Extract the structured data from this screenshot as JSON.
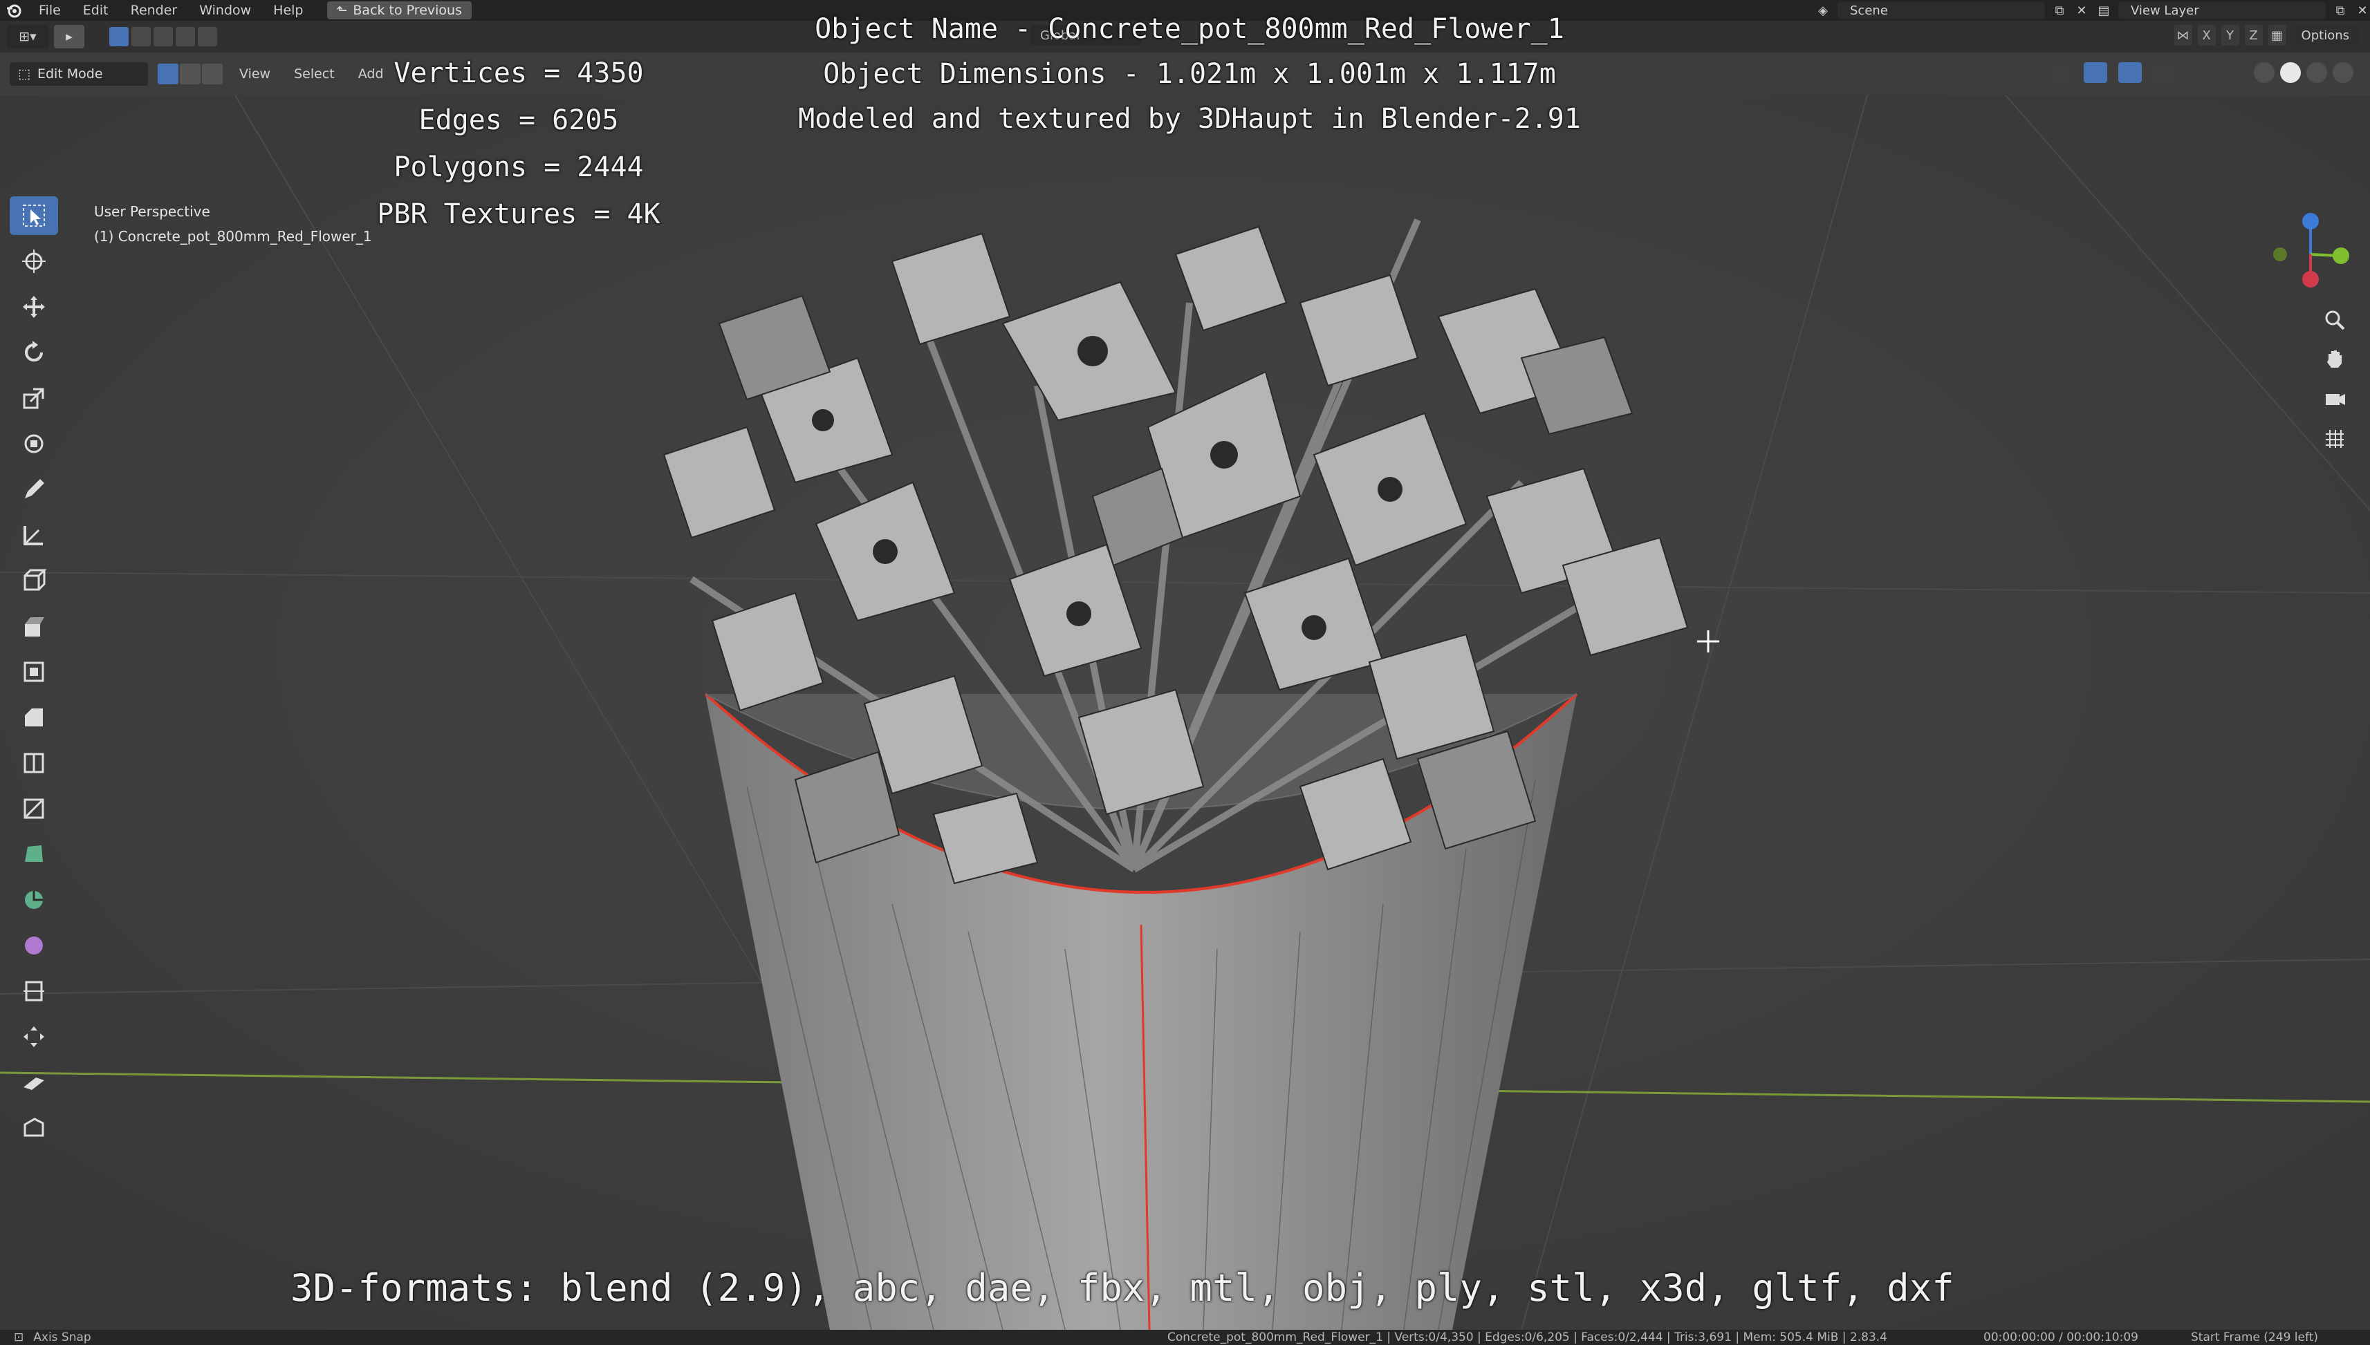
{
  "menu": {
    "items": [
      "File",
      "Edit",
      "Render",
      "Window",
      "Help"
    ],
    "back_button": "Back to Previous"
  },
  "topbar_right": {
    "scene": "Scene",
    "view_layer": "View Layer"
  },
  "header": {
    "orientation": "Global",
    "axes": [
      "X",
      "Y",
      "Z"
    ],
    "options": "Options"
  },
  "viewport_header": {
    "mode": "Edit Mode",
    "menus": [
      "View",
      "Select",
      "Add"
    ]
  },
  "viewport_info": {
    "perspective": "User Perspective",
    "object_line": "(1) Concrete_pot_800mm_Red_Flower_1"
  },
  "overlay": {
    "vertices": "Vertices = 4350",
    "edges": "Edges = 6205",
    "polygons": "Polygons = 2444",
    "textures": "PBR Textures = 4K",
    "object_name": "Object Name - Concrete_pot_800mm_Red_Flower_1",
    "object_dimensions": "Object Dimensions -  1.021m x 1.001m x 1.117m",
    "credits": "Modeled and textured by 3DHaupt in Blender-2.91",
    "formats": "3D-formats: blend (2.9), abc, dae, fbx, mtl, obj, ply, stl, x3d, gltf, dxf"
  },
  "statusbar": {
    "axis_snap": "Axis Snap",
    "stats": "Concrete_pot_800mm_Red_Flower_1 | Verts:0/4,350 | Edges:0/6,205 | Faces:0/2,444 | Tris:3,691 | Mem: 505.4 MiB | 2.83.4",
    "time": "00:00:00:00 / 00:00:10:09",
    "frame": "Start Frame (249 left)"
  },
  "colors": {
    "background": "#3d3d3d",
    "accent": "#4772b3",
    "seam": "#e03a2a",
    "grid_x": "#8ab04a"
  },
  "icons": [
    "blender-logo-icon",
    "cursor-icon",
    "move-icon",
    "rotate-icon",
    "scale-icon",
    "transform-icon",
    "annotate-icon",
    "measure-icon",
    "zoom-icon",
    "hand-icon",
    "camera-icon",
    "grid-icon"
  ]
}
